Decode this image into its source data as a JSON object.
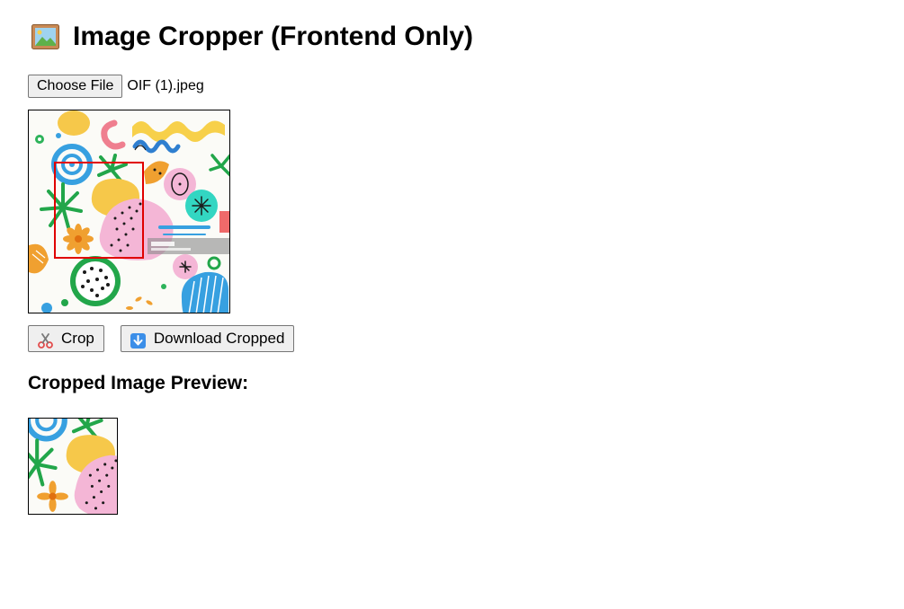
{
  "page": {
    "title": "Image Cropper (Frontend Only)",
    "title_icon": "framed-picture-icon"
  },
  "file_input": {
    "button_label": "Choose File",
    "file_name": "OIF (1).jpeg"
  },
  "actions": {
    "crop_label": "Crop",
    "crop_icon": "scissors-icon",
    "download_label": "Download Cropped",
    "download_icon": "down-arrow-icon"
  },
  "preview": {
    "heading": "Cropped Image Preview:"
  },
  "colors": {
    "crop_rect": "#e00000",
    "button_bg": "#efefef",
    "button_border": "#767676"
  }
}
